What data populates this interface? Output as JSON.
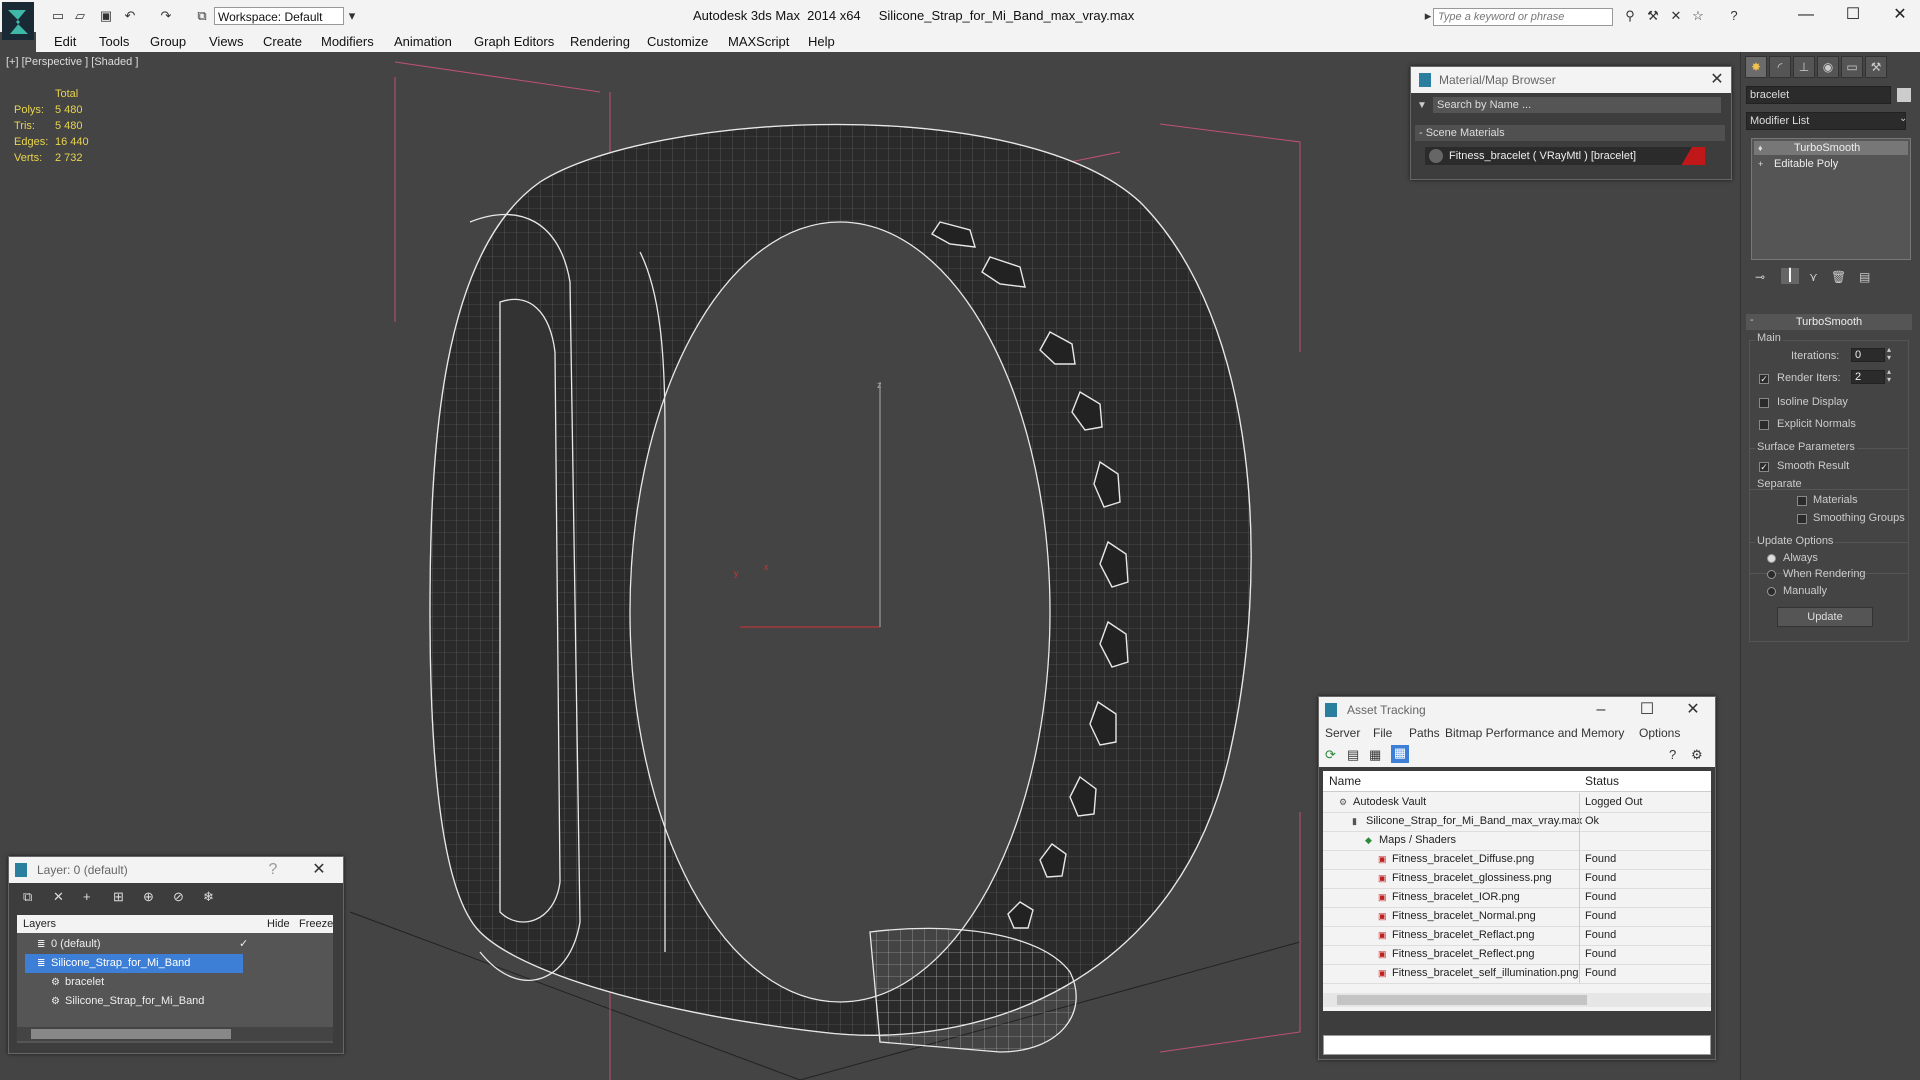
{
  "app": {
    "title": "Autodesk 3ds Max  2014 x64     Silicone_Strap_for_Mi_Band_max_vray.max",
    "workspace": "Workspace: Default",
    "search_placeholder": "Type a keyword or phrase"
  },
  "menu": [
    "Edit",
    "Tools",
    "Group",
    "Views",
    "Create",
    "Modifiers",
    "Animation",
    "Graph Editors",
    "Rendering",
    "Customize",
    "MAXScript",
    "Help"
  ],
  "viewport": {
    "label": "[+] [Perspective ] [Shaded ]",
    "stats": {
      "header": "Total",
      "rows": [
        {
          "label": "Polys:",
          "value": "5 480"
        },
        {
          "label": "Tris:",
          "value": "5 480"
        },
        {
          "label": "Edges:",
          "value": "16 440"
        },
        {
          "label": "Verts:",
          "value": "2 732"
        }
      ]
    },
    "axis_z": "z",
    "axis_x": "x",
    "axis_y": "y"
  },
  "material_browser": {
    "title": "Material/Map Browser",
    "search_placeholder": "Search by Name ...",
    "section": "- Scene Materials",
    "item": "Fitness_bracelet  ( VRayMtl )  [bracelet]"
  },
  "command_panel": {
    "object_name": "bracelet",
    "modifier_list": "Modifier List",
    "stack": [
      "TurboSmooth",
      "Editable Poly"
    ],
    "rollout_title": "TurboSmooth",
    "main_label": "Main",
    "iterations_label": "Iterations:",
    "iterations_value": "0",
    "render_iters_label": "Render Iters:",
    "render_iters_value": "2",
    "isoline_label": "Isoline Display",
    "explicit_label": "Explicit Normals",
    "surface_label": "Surface Parameters",
    "smooth_result_label": "Smooth Result",
    "separate_label": "Separate",
    "materials_label": "Materials",
    "smoothing_groups_label": "Smoothing Groups",
    "update_options_label": "Update Options",
    "always_label": "Always",
    "when_rendering_label": "When Rendering",
    "manually_label": "Manually",
    "update_button": "Update"
  },
  "layer_window": {
    "title": "Layer: 0 (default)",
    "help": "?",
    "columns": [
      "Layers",
      "Hide",
      "Freeze"
    ],
    "rows": [
      {
        "name": "0 (default)",
        "indent": 0
      },
      {
        "name": "Silicone_Strap_for_Mi_Band",
        "indent": 0,
        "selected": true
      },
      {
        "name": "bracelet",
        "indent": 1
      },
      {
        "name": "Silicone_Strap_for_Mi_Band",
        "indent": 1
      }
    ]
  },
  "asset_tracking": {
    "title": "Asset Tracking",
    "menu": [
      "Server",
      "File",
      "Paths",
      "Bitmap Performance and Memory",
      "Options"
    ],
    "columns": [
      "Name",
      "Status"
    ],
    "rows": [
      {
        "name": "Autodesk Vault",
        "status": "Logged Out",
        "indent": 0
      },
      {
        "name": "Silicone_Strap_for_Mi_Band_max_vray.max",
        "status": "Ok",
        "indent": 1
      },
      {
        "name": "Maps / Shaders",
        "status": "",
        "indent": 2
      },
      {
        "name": "Fitness_bracelet_Diffuse.png",
        "status": "Found",
        "indent": 3
      },
      {
        "name": "Fitness_bracelet_glossiness.png",
        "status": "Found",
        "indent": 3
      },
      {
        "name": "Fitness_bracelet_IOR.png",
        "status": "Found",
        "indent": 3
      },
      {
        "name": "Fitness_bracelet_Normal.png",
        "status": "Found",
        "indent": 3
      },
      {
        "name": "Fitness_bracelet_Reflact.png",
        "status": "Found",
        "indent": 3
      },
      {
        "name": "Fitness_bracelet_Reflect.png",
        "status": "Found",
        "indent": 3
      },
      {
        "name": "Fitness_bracelet_self_illumination.png",
        "status": "Found",
        "indent": 3
      }
    ]
  }
}
